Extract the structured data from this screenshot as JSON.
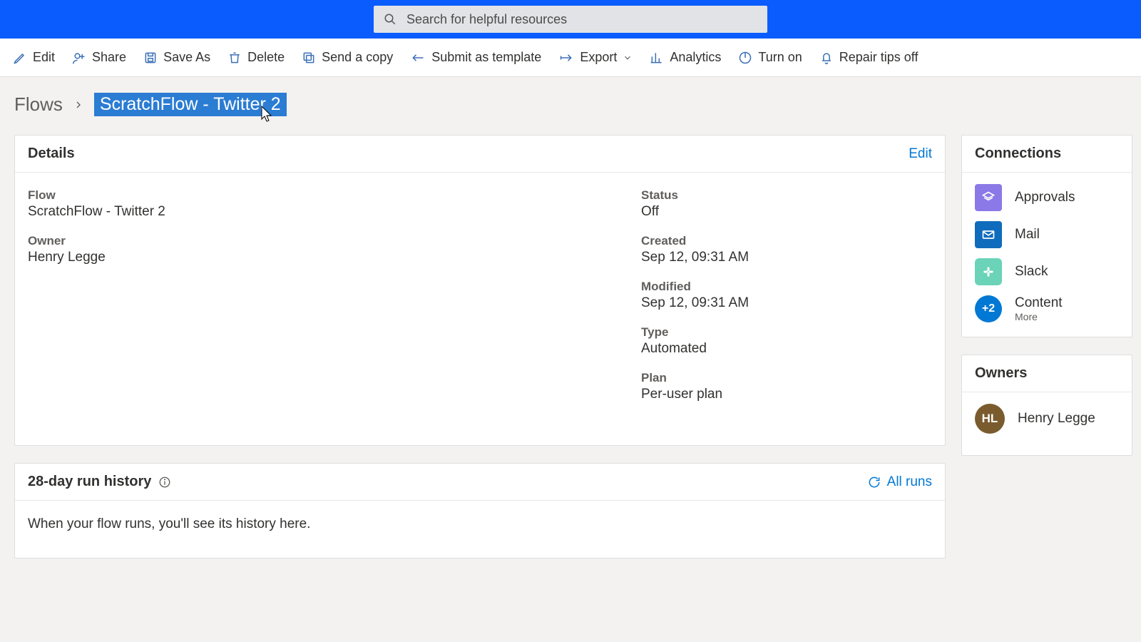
{
  "search": {
    "placeholder": "Search for helpful resources"
  },
  "commandbar": {
    "edit": "Edit",
    "share": "Share",
    "saveas": "Save As",
    "delete": "Delete",
    "sendcopy": "Send a copy",
    "submit": "Submit as template",
    "export": "Export",
    "analytics": "Analytics",
    "turnon": "Turn on",
    "repair": "Repair tips off"
  },
  "breadcrumb": {
    "root": "Flows",
    "current": "ScratchFlow - Twitter 2"
  },
  "details": {
    "title": "Details",
    "edit": "Edit",
    "flow_label": "Flow",
    "flow_value": "ScratchFlow - Twitter 2",
    "owner_label": "Owner",
    "owner_value": "Henry Legge",
    "status_label": "Status",
    "status_value": "Off",
    "created_label": "Created",
    "created_value": "Sep 12, 09:31 AM",
    "modified_label": "Modified",
    "modified_value": "Sep 12, 09:31 AM",
    "type_label": "Type",
    "type_value": "Automated",
    "plan_label": "Plan",
    "plan_value": "Per-user plan"
  },
  "runs": {
    "title": "28-day run history",
    "all": "All runs",
    "empty": "When your flow runs, you'll see its history here."
  },
  "connections": {
    "title": "Connections",
    "items": [
      {
        "label": "Approvals"
      },
      {
        "label": "Mail"
      },
      {
        "label": "Slack"
      }
    ],
    "more_badge": "+2",
    "more_label": "Content",
    "more_sub": "More"
  },
  "owners": {
    "title": "Owners",
    "initials": "HL",
    "name": "Henry Legge"
  }
}
